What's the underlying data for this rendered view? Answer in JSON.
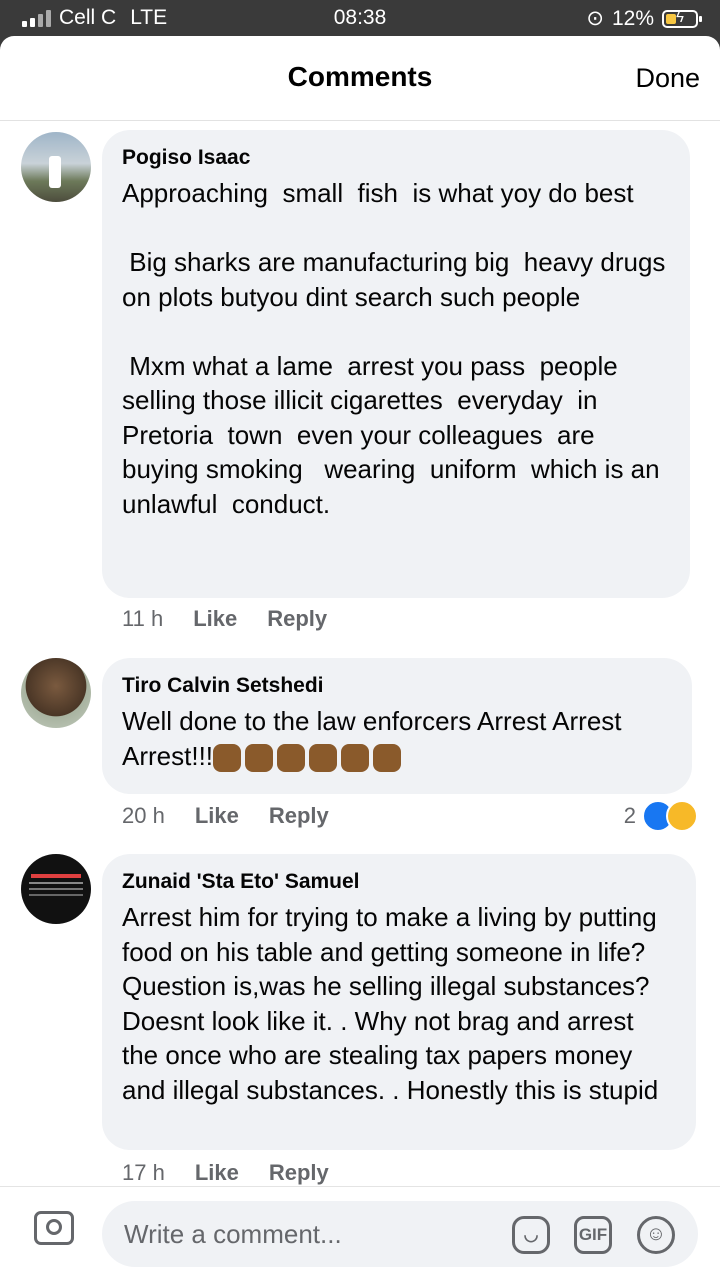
{
  "status_bar": {
    "carrier": "Cell C",
    "network": "LTE",
    "time": "08:38",
    "battery": "12%"
  },
  "header": {
    "title": "Comments",
    "done_label": "Done"
  },
  "comments": [
    {
      "author": "Pogiso Isaac",
      "text": "Approaching  small  fish  is what yoy do best\n\n Big sharks are manufacturing big  heavy drugs on plots butyou dint search such people\n\n Mxm what a lame  arrest you pass  people selling those illicit cigarettes  everyday  in Pretoria  town  even your colleagues  are buying smoking   wearing  uniform  which is an unlawful  conduct.",
      "time": "11 h",
      "like": "Like",
      "reply": "Reply"
    },
    {
      "author": "Tiro Calvin Setshedi",
      "text": "Well done to the law enforcers Arrest Arrest Arrest!!!",
      "time": "20 h",
      "like": "Like",
      "reply": "Reply",
      "reaction_count": "2"
    },
    {
      "author": "Zunaid 'Sta Eto' Samuel",
      "text": "Arrest him for trying to make a living by putting food on his table and getting someone in life? Question is,was he selling illegal substances? Doesnt look like it. . Why not brag and arrest the once who are stealing tax papers money and illegal substances. . Honestly this is stupid",
      "time": "17 h",
      "like": "Like",
      "reply": "Reply"
    }
  ],
  "composer": {
    "placeholder": "Write a comment...",
    "gif_label": "GIF"
  },
  "colors": {
    "accent": "#1877f2",
    "bubble": "#f0f2f5",
    "meta": "#65676b"
  }
}
